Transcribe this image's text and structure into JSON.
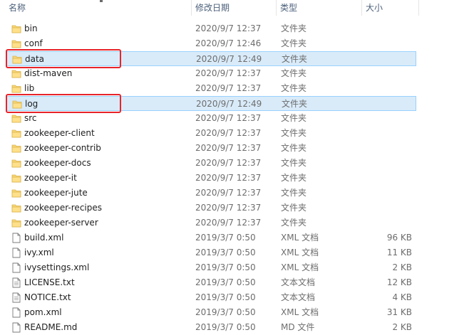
{
  "columns": {
    "name": "名称",
    "date": "修改日期",
    "type": "类型",
    "size": "大小"
  },
  "colors": {
    "selection_bg": "#d9ebf9",
    "selection_border": "#99d1ff",
    "highlight": "#e8242a",
    "folder": "#f8d775"
  },
  "files": [
    {
      "name": "bin",
      "date": "2020/9/7 12:37",
      "type": "文件夹",
      "size": "",
      "icon": "folder-icon",
      "selected": false
    },
    {
      "name": "conf",
      "date": "2020/9/7 12:46",
      "type": "文件夹",
      "size": "",
      "icon": "folder-icon",
      "selected": false
    },
    {
      "name": "data",
      "date": "2020/9/7 12:49",
      "type": "文件夹",
      "size": "",
      "icon": "folder-icon",
      "selected": true
    },
    {
      "name": "dist-maven",
      "date": "2020/9/7 12:37",
      "type": "文件夹",
      "size": "",
      "icon": "folder-icon",
      "selected": false
    },
    {
      "name": "lib",
      "date": "2020/9/7 12:37",
      "type": "文件夹",
      "size": "",
      "icon": "folder-icon",
      "selected": false
    },
    {
      "name": "log",
      "date": "2020/9/7 12:49",
      "type": "文件夹",
      "size": "",
      "icon": "folder-icon",
      "selected": true
    },
    {
      "name": "src",
      "date": "2020/9/7 12:37",
      "type": "文件夹",
      "size": "",
      "icon": "folder-icon",
      "selected": false
    },
    {
      "name": "zookeeper-client",
      "date": "2020/9/7 12:37",
      "type": "文件夹",
      "size": "",
      "icon": "folder-icon",
      "selected": false
    },
    {
      "name": "zookeeper-contrib",
      "date": "2020/9/7 12:37",
      "type": "文件夹",
      "size": "",
      "icon": "folder-icon",
      "selected": false
    },
    {
      "name": "zookeeper-docs",
      "date": "2020/9/7 12:37",
      "type": "文件夹",
      "size": "",
      "icon": "folder-icon",
      "selected": false
    },
    {
      "name": "zookeeper-it",
      "date": "2020/9/7 12:37",
      "type": "文件夹",
      "size": "",
      "icon": "folder-icon",
      "selected": false
    },
    {
      "name": "zookeeper-jute",
      "date": "2020/9/7 12:37",
      "type": "文件夹",
      "size": "",
      "icon": "folder-icon",
      "selected": false
    },
    {
      "name": "zookeeper-recipes",
      "date": "2020/9/7 12:37",
      "type": "文件夹",
      "size": "",
      "icon": "folder-icon",
      "selected": false
    },
    {
      "name": "zookeeper-server",
      "date": "2020/9/7 12:37",
      "type": "文件夹",
      "size": "",
      "icon": "folder-icon",
      "selected": false
    },
    {
      "name": "build.xml",
      "date": "2019/3/7 0:50",
      "type": "XML 文档",
      "size": "96 KB",
      "icon": "document-icon",
      "selected": false
    },
    {
      "name": "ivy.xml",
      "date": "2019/3/7 0:50",
      "type": "XML 文档",
      "size": "11 KB",
      "icon": "document-icon",
      "selected": false
    },
    {
      "name": "ivysettings.xml",
      "date": "2019/3/7 0:50",
      "type": "XML 文档",
      "size": "2 KB",
      "icon": "document-icon",
      "selected": false
    },
    {
      "name": "LICENSE.txt",
      "date": "2019/3/7 0:50",
      "type": "文本文档",
      "size": "12 KB",
      "icon": "text-document-icon",
      "selected": false
    },
    {
      "name": "NOTICE.txt",
      "date": "2019/3/7 0:50",
      "type": "文本文档",
      "size": "4 KB",
      "icon": "text-document-icon",
      "selected": false
    },
    {
      "name": "pom.xml",
      "date": "2019/3/7 0:50",
      "type": "XML 文档",
      "size": "31 KB",
      "icon": "document-icon",
      "selected": false
    },
    {
      "name": "README.md",
      "date": "2019/3/7 0:50",
      "type": "MD 文件",
      "size": "2 KB",
      "icon": "document-icon",
      "selected": false
    }
  ],
  "annotations": [
    {
      "target": "data",
      "shape": "red-rectangle"
    },
    {
      "target": "log",
      "shape": "red-rectangle"
    }
  ]
}
